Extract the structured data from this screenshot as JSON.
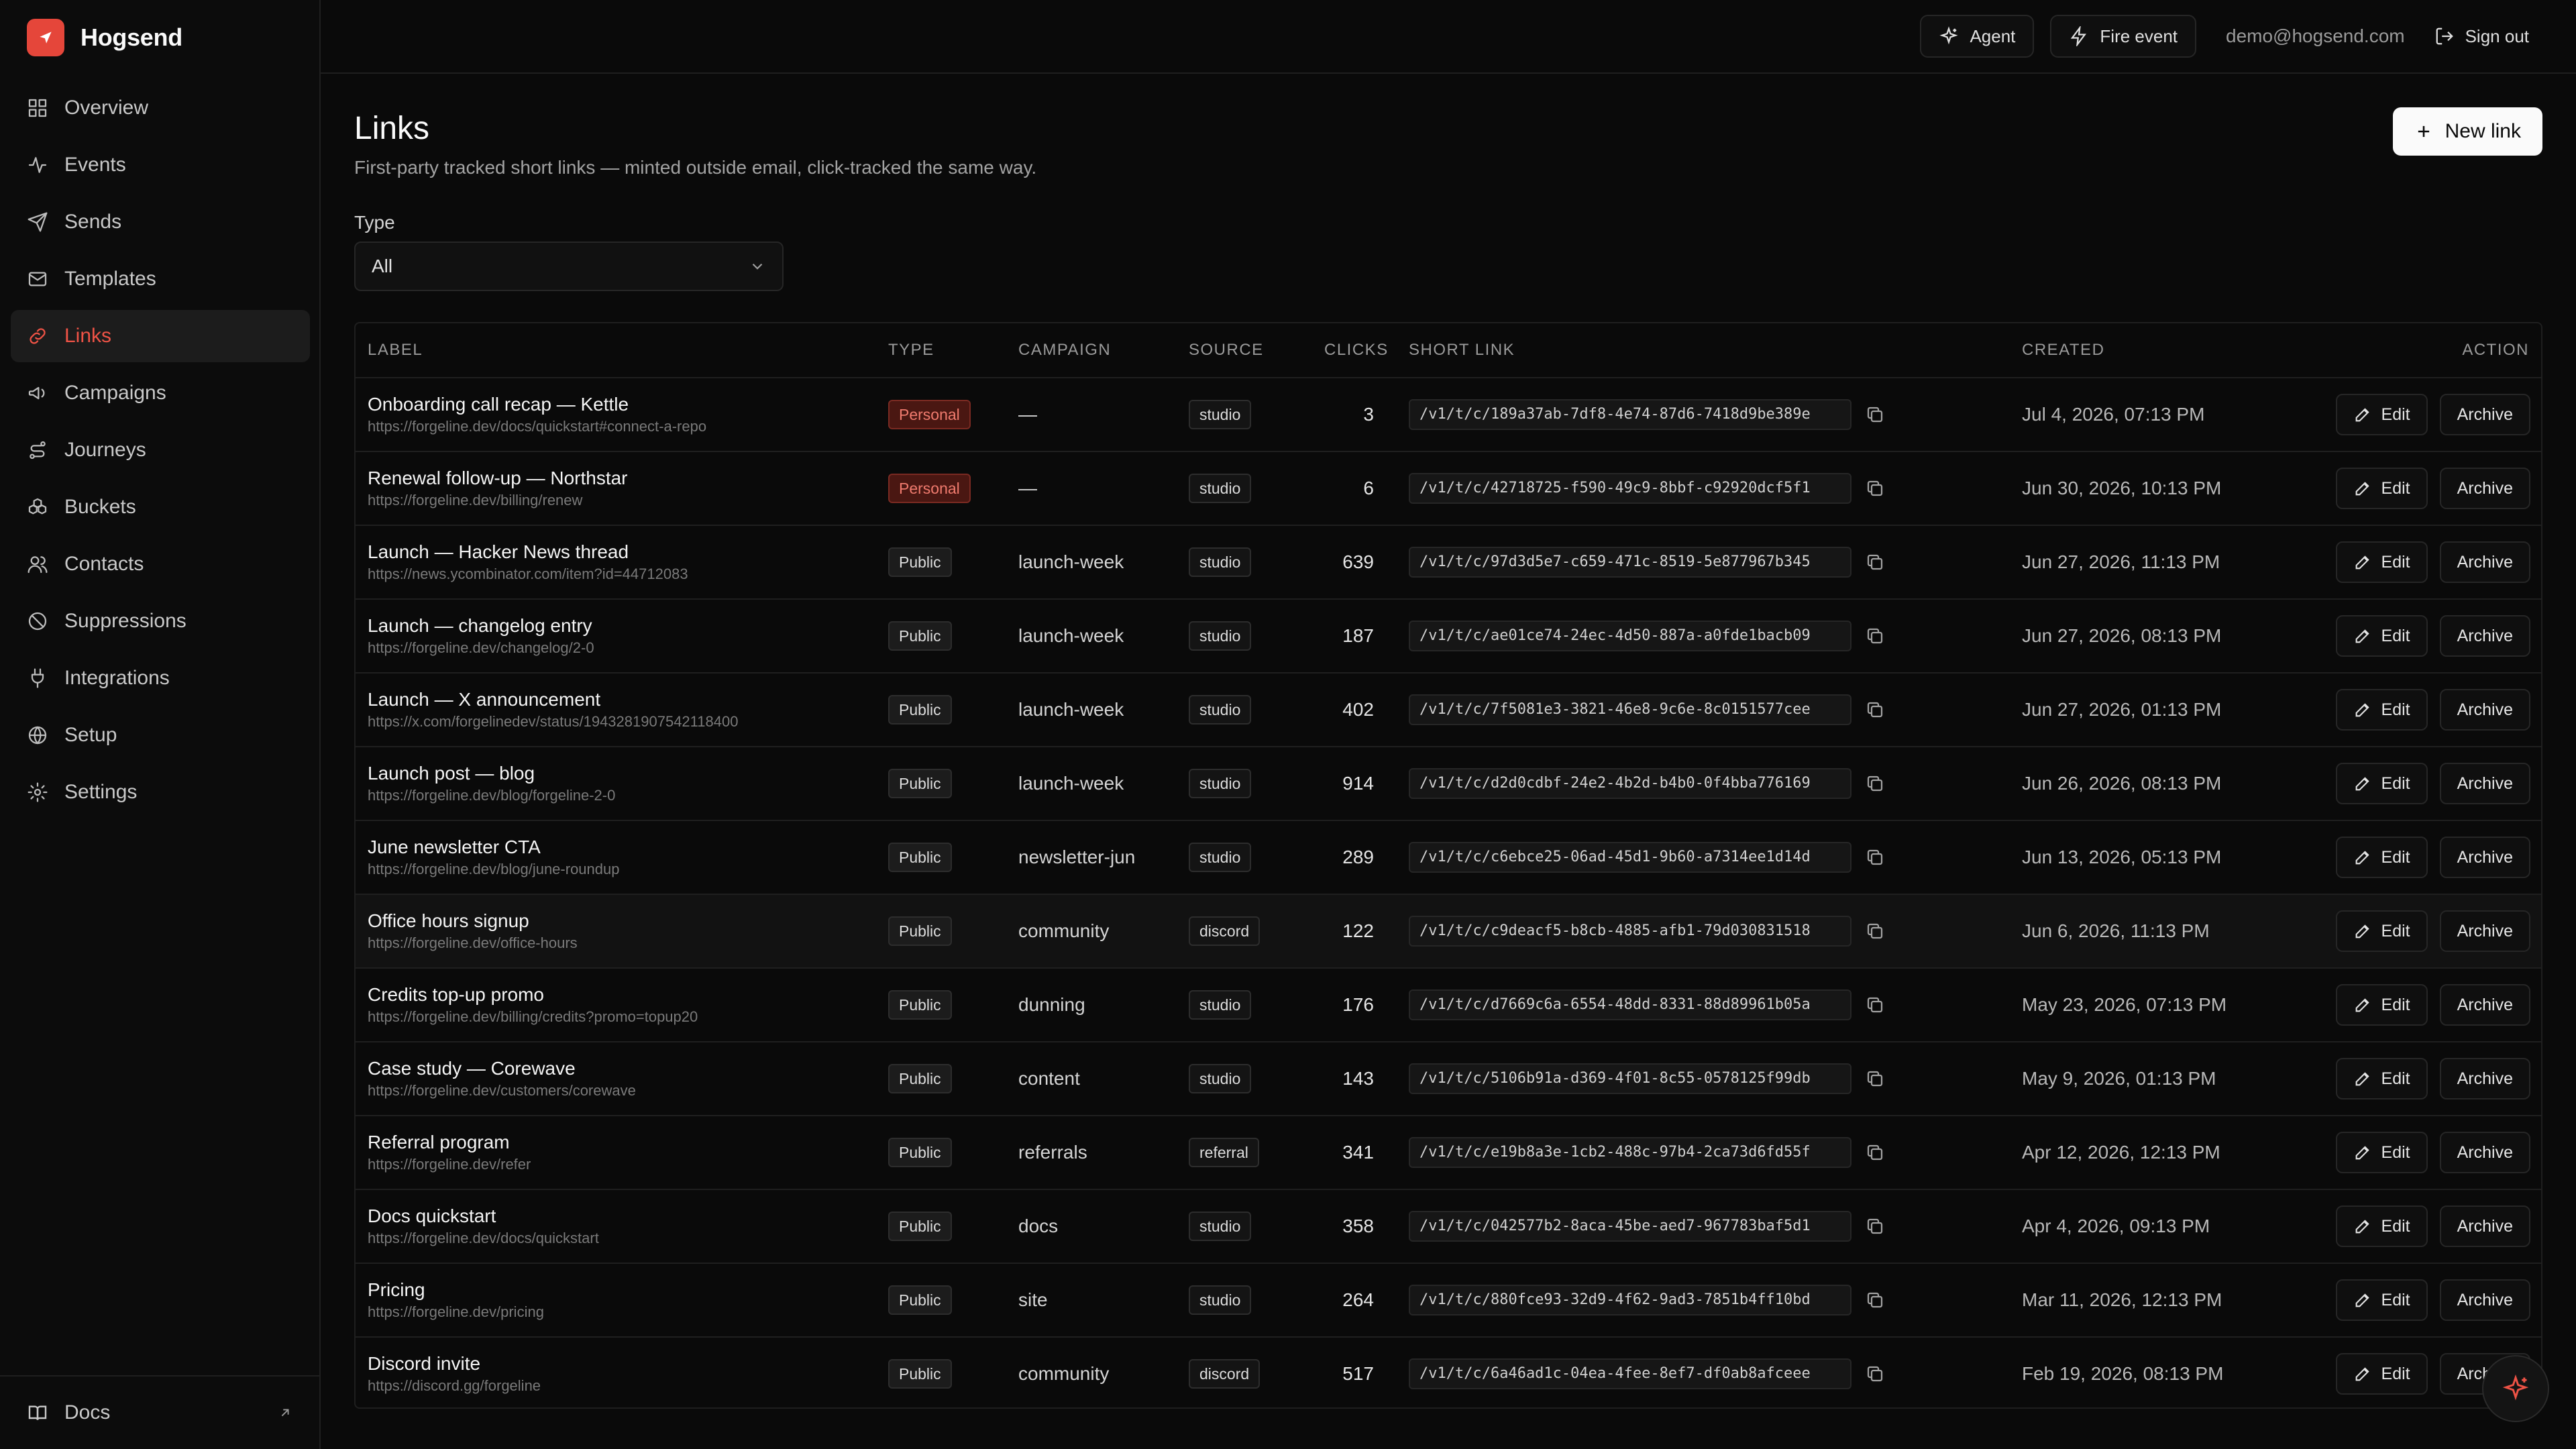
{
  "brand": {
    "name": "Hogsend",
    "accent": "#e5463a"
  },
  "sidebar": {
    "items": [
      {
        "label": "Overview",
        "icon": "grid-icon"
      },
      {
        "label": "Events",
        "icon": "activity-icon"
      },
      {
        "label": "Sends",
        "icon": "send-icon"
      },
      {
        "label": "Templates",
        "icon": "mail-icon"
      },
      {
        "label": "Links",
        "icon": "link-icon",
        "active": true
      },
      {
        "label": "Campaigns",
        "icon": "megaphone-icon"
      },
      {
        "label": "Journeys",
        "icon": "route-icon"
      },
      {
        "label": "Buckets",
        "icon": "boxes-icon"
      },
      {
        "label": "Contacts",
        "icon": "users-icon"
      },
      {
        "label": "Suppressions",
        "icon": "ban-icon"
      },
      {
        "label": "Integrations",
        "icon": "plug-icon"
      },
      {
        "label": "Setup",
        "icon": "globe-icon"
      },
      {
        "label": "Settings",
        "icon": "gear-icon"
      }
    ],
    "footer": {
      "label": "Docs"
    }
  },
  "topbar": {
    "agent_label": "Agent",
    "fire_event_label": "Fire event",
    "email": "demo@hogsend.com",
    "signout_label": "Sign out"
  },
  "page": {
    "title": "Links",
    "subtitle": "First-party tracked short links — minted outside email, click-tracked the same way.",
    "new_button": "New link",
    "filter": {
      "label": "Type",
      "value": "All"
    }
  },
  "table": {
    "headers": {
      "label": "LABEL",
      "type": "TYPE",
      "campaign": "CAMPAIGN",
      "source": "SOURCE",
      "clicks": "CLICKS",
      "short_link": "SHORT LINK",
      "created": "CREATED",
      "action": "ACTION"
    },
    "edit_label": "Edit",
    "archive_label": "Archive",
    "rows": [
      {
        "title": "Onboarding call recap — Kettle",
        "url": "https://forgeline.dev/docs/quickstart#connect-a-repo",
        "type": "Personal",
        "campaign": "—",
        "source": "studio",
        "clicks": "3",
        "short": "/v1/t/c/189a37ab-7df8-4e74-87d6-7418d9be389e",
        "created": "Jul 4, 2026, 07:13 PM"
      },
      {
        "title": "Renewal follow-up — Northstar",
        "url": "https://forgeline.dev/billing/renew",
        "type": "Personal",
        "campaign": "—",
        "source": "studio",
        "clicks": "6",
        "short": "/v1/t/c/42718725-f590-49c9-8bbf-c92920dcf5f1",
        "created": "Jun 30, 2026, 10:13 PM"
      },
      {
        "title": "Launch — Hacker News thread",
        "url": "https://news.ycombinator.com/item?id=44712083",
        "type": "Public",
        "campaign": "launch-week",
        "source": "studio",
        "clicks": "639",
        "short": "/v1/t/c/97d3d5e7-c659-471c-8519-5e877967b345",
        "created": "Jun 27, 2026, 11:13 PM"
      },
      {
        "title": "Launch — changelog entry",
        "url": "https://forgeline.dev/changelog/2-0",
        "type": "Public",
        "campaign": "launch-week",
        "source": "studio",
        "clicks": "187",
        "short": "/v1/t/c/ae01ce74-24ec-4d50-887a-a0fde1bacb09",
        "created": "Jun 27, 2026, 08:13 PM"
      },
      {
        "title": "Launch — X announcement",
        "url": "https://x.com/forgelinedev/status/1943281907542118400",
        "type": "Public",
        "campaign": "launch-week",
        "source": "studio",
        "clicks": "402",
        "short": "/v1/t/c/7f5081e3-3821-46e8-9c6e-8c0151577cee",
        "created": "Jun 27, 2026, 01:13 PM"
      },
      {
        "title": "Launch post — blog",
        "url": "https://forgeline.dev/blog/forgeline-2-0",
        "type": "Public",
        "campaign": "launch-week",
        "source": "studio",
        "clicks": "914",
        "short": "/v1/t/c/d2d0cdbf-24e2-4b2d-b4b0-0f4bba776169",
        "created": "Jun 26, 2026, 08:13 PM"
      },
      {
        "title": "June newsletter CTA",
        "url": "https://forgeline.dev/blog/june-roundup",
        "type": "Public",
        "campaign": "newsletter-jun",
        "source": "studio",
        "clicks": "289",
        "short": "/v1/t/c/c6ebce25-06ad-45d1-9b60-a7314ee1d14d",
        "created": "Jun 13, 2026, 05:13 PM"
      },
      {
        "title": "Office hours signup",
        "url": "https://forgeline.dev/office-hours",
        "type": "Public",
        "campaign": "community",
        "source": "discord",
        "clicks": "122",
        "short": "/v1/t/c/c9deacf5-b8cb-4885-afb1-79d030831518",
        "created": "Jun 6, 2026, 11:13 PM"
      },
      {
        "title": "Credits top-up promo",
        "url": "https://forgeline.dev/billing/credits?promo=topup20",
        "type": "Public",
        "campaign": "dunning",
        "source": "studio",
        "clicks": "176",
        "short": "/v1/t/c/d7669c6a-6554-48dd-8331-88d89961b05a",
        "created": "May 23, 2026, 07:13 PM"
      },
      {
        "title": "Case study — Corewave",
        "url": "https://forgeline.dev/customers/corewave",
        "type": "Public",
        "campaign": "content",
        "source": "studio",
        "clicks": "143",
        "short": "/v1/t/c/5106b91a-d369-4f01-8c55-0578125f99db",
        "created": "May 9, 2026, 01:13 PM"
      },
      {
        "title": "Referral program",
        "url": "https://forgeline.dev/refer",
        "type": "Public",
        "campaign": "referrals",
        "source": "referral",
        "clicks": "341",
        "short": "/v1/t/c/e19b8a3e-1cb2-488c-97b4-2ca73d6fd55f",
        "created": "Apr 12, 2026, 12:13 PM"
      },
      {
        "title": "Docs quickstart",
        "url": "https://forgeline.dev/docs/quickstart",
        "type": "Public",
        "campaign": "docs",
        "source": "studio",
        "clicks": "358",
        "short": "/v1/t/c/042577b2-8aca-45be-aed7-967783baf5d1",
        "created": "Apr 4, 2026, 09:13 PM"
      },
      {
        "title": "Pricing",
        "url": "https://forgeline.dev/pricing",
        "type": "Public",
        "campaign": "site",
        "source": "studio",
        "clicks": "264",
        "short": "/v1/t/c/880fce93-32d9-4f62-9ad3-7851b4ff10bd",
        "created": "Mar 11, 2026, 12:13 PM"
      },
      {
        "title": "Discord invite",
        "url": "https://discord.gg/forgeline",
        "type": "Public",
        "campaign": "community",
        "source": "discord",
        "clicks": "517",
        "short": "/v1/t/c/6a46ad1c-04ea-4fee-8ef7-df0ab8afceee",
        "created": "Feb 19, 2026, 08:13 PM"
      }
    ]
  }
}
